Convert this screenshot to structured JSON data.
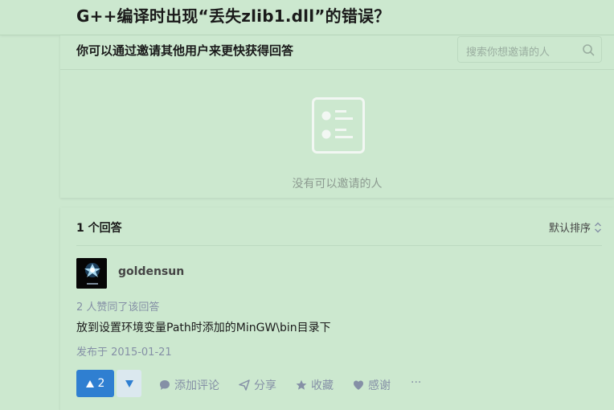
{
  "question": {
    "title": "G++编译时出现“丢失zlib1.dll”的错误？"
  },
  "invite": {
    "title": "你可以通过邀请其他用户来更快获得回答",
    "search_placeholder": "搜索你想邀请的人",
    "empty_text": "没有可以邀请的人"
  },
  "answers": {
    "count_label": "1 个回答",
    "sort_label": "默认排序",
    "items": [
      {
        "author": "goldensun",
        "voters_text": "2 人赞同了该回答",
        "content": "放到设置环境变量Path时添加的MinGW\\bin目录下",
        "published": "发布于 2015-01-21",
        "upvotes": "2",
        "actions": {
          "comment": "添加评论",
          "share": "分享",
          "favorite": "收藏",
          "thanks": "感谢",
          "more": "···"
        }
      }
    ]
  },
  "colors": {
    "background": "#cce8cf",
    "accent": "#2f7fd1",
    "muted_text": "#8590a6"
  }
}
